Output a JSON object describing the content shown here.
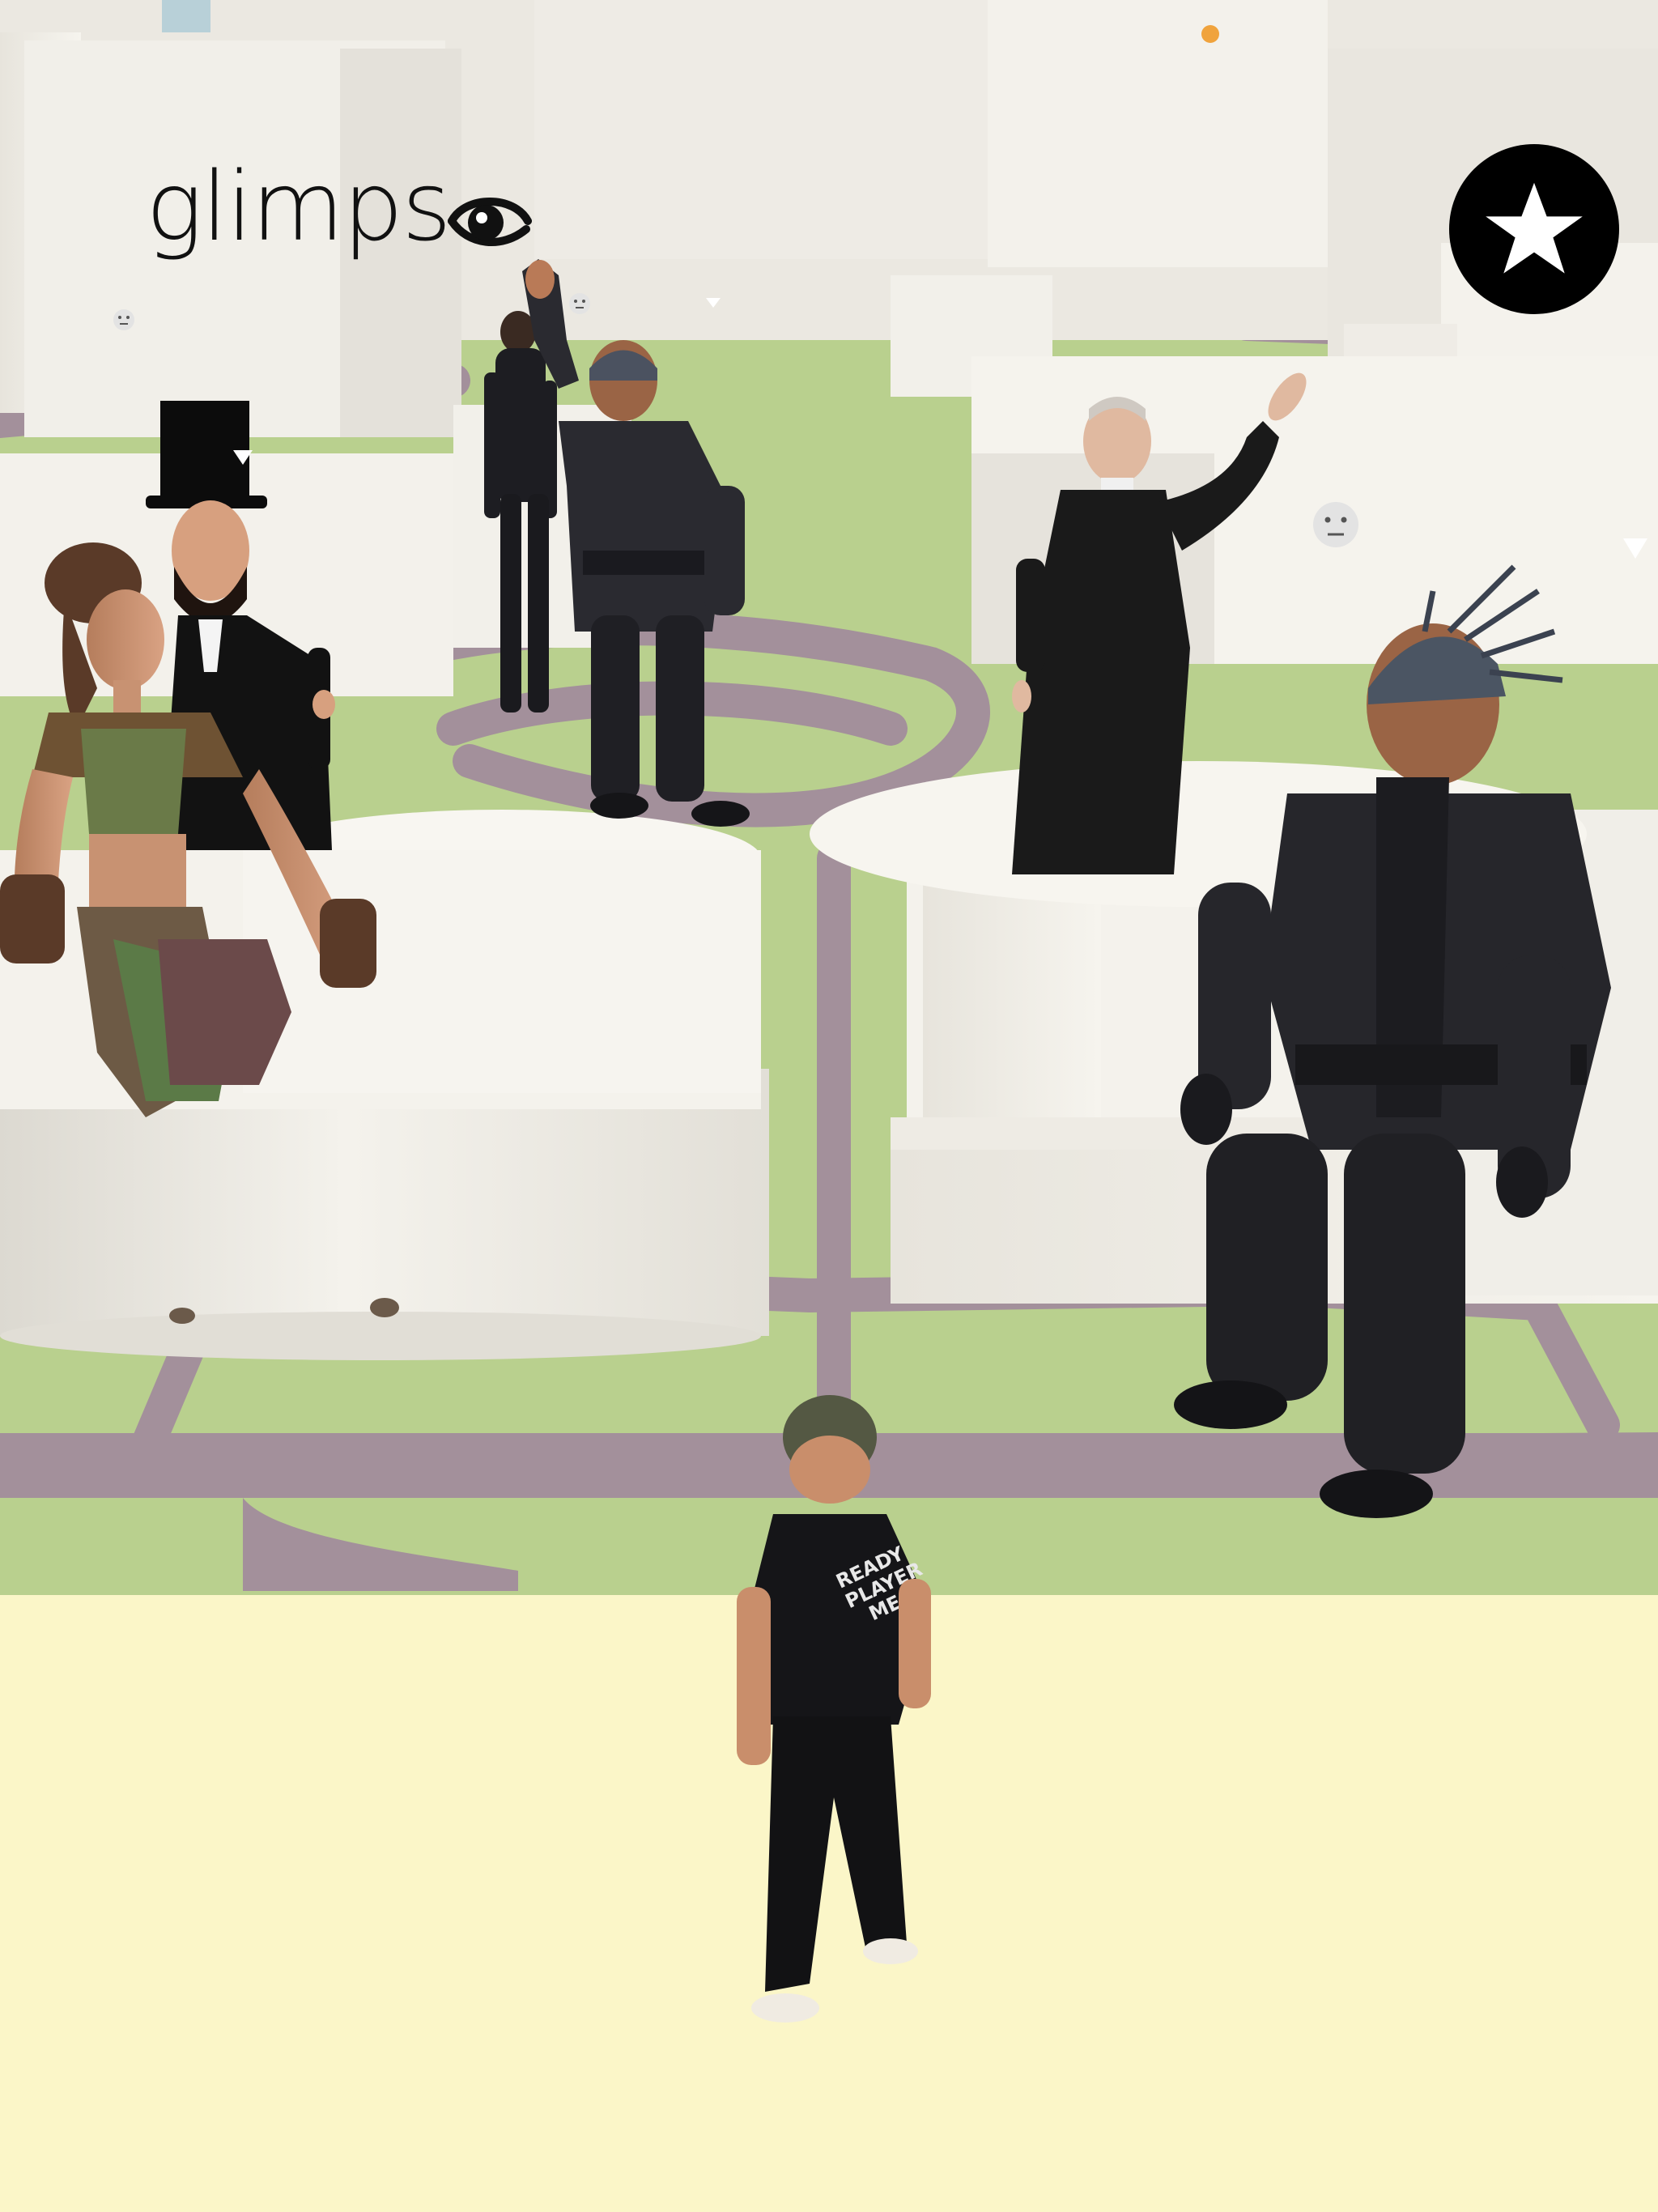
{
  "app": {
    "logo_text": "glimps",
    "logo_icon": "eye-icon"
  },
  "hud": {
    "favorite_button_icon": "star-icon"
  },
  "scene": {
    "shirt_text": [
      "READY",
      "PLAYER",
      "ME"
    ],
    "emoji_markers": [
      "neutral-face-icon",
      "neutral-face-icon",
      "neutral-face-icon"
    ],
    "colors": {
      "ground": "#fbf6c8",
      "grass": "#b7cf8c",
      "path": "#a08c99",
      "buildings": "#eeebe4"
    }
  }
}
